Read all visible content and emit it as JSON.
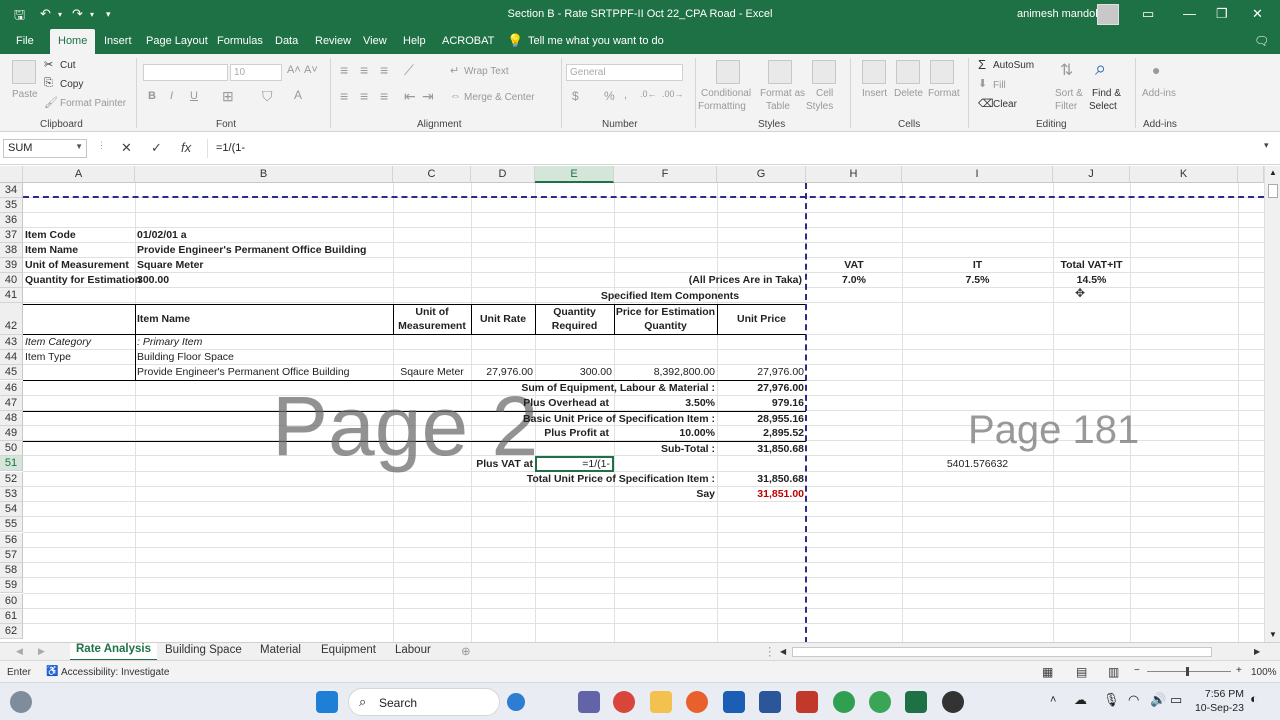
{
  "window": {
    "title": "Section B - Rate SRTPPF-II Oct 22_CPA Road  -  Excel",
    "user": "animesh mandol"
  },
  "ribbon_tabs": [
    "File",
    "Home",
    "Insert",
    "Page Layout",
    "Formulas",
    "Data",
    "Review",
    "View",
    "Help",
    "ACROBAT"
  ],
  "tell_me": "Tell me what you want to do",
  "ribbon": {
    "clipboard": {
      "paste": "Paste",
      "cut": "Cut",
      "copy": "Copy",
      "format_painter": "Format Painter",
      "label": "Clipboard"
    },
    "font": {
      "size": "10",
      "label": "Font"
    },
    "alignment": {
      "wrap": "Wrap Text",
      "merge": "Merge & Center",
      "label": "Alignment"
    },
    "number": {
      "format": "General",
      "label": "Number"
    },
    "styles": {
      "conditional": "Conditional",
      "conditional2": "Formatting",
      "format_as": "Format as",
      "format_as2": "Table",
      "cell": "Cell",
      "cell2": "Styles",
      "label": "Styles"
    },
    "cells": {
      "insert": "Insert",
      "delete": "Delete",
      "format": "Format",
      "label": "Cells"
    },
    "editing": {
      "autosum": "AutoSum",
      "fill": "Fill",
      "clear": "Clear",
      "sort": "Sort &",
      "sort2": "Filter",
      "find": "Find &",
      "find2": "Select",
      "label": "Editing"
    },
    "addins": {
      "addins": "Add-ins",
      "label": "Add-ins"
    }
  },
  "formula_bar": {
    "name_box": "SUM",
    "formula": "=1/(1-"
  },
  "columns": [
    "A",
    "B",
    "C",
    "D",
    "E",
    "F",
    "G",
    "H",
    "I",
    "J",
    "K"
  ],
  "rows": [
    "34",
    "35",
    "36",
    "37",
    "38",
    "39",
    "40",
    "41",
    "42",
    "43",
    "44",
    "45",
    "46",
    "47",
    "48",
    "49",
    "50",
    "51",
    "52",
    "53",
    "54",
    "55",
    "56",
    "57",
    "58",
    "59",
    "60",
    "61",
    "62"
  ],
  "cells": {
    "a37": "Item Code",
    "b37": "01/02/01 a",
    "a38": "Item Name",
    "b38": "Provide Engineer's Permanent Office Building",
    "a39": "Unit of Measurement",
    "b39": "Square Meter",
    "h39": "VAT",
    "i39": "IT",
    "j39": "Total VAT+IT",
    "a40": "Quantity for Estimation",
    "b40": "300.00",
    "g40": "(All Prices Are in Taka)",
    "h40": "7.0%",
    "i40": "7.5%",
    "j40": "14.5%",
    "f41": "Specified Item Components",
    "b42": "Item Name",
    "c42a": "Unit of",
    "c42b": "Measurement",
    "d42": "Unit Rate",
    "e42a": "Quantity",
    "e42b": "Required",
    "f42a": "Price for Estimation",
    "f42b": "Quantity",
    "g42": "Unit Price",
    "a43": "Item Category",
    "b43": ": Primary Item",
    "a44": "Item Type",
    "b44": "Building Floor Space",
    "b45": "Provide Engineer's Permanent Office Building",
    "c45": "Sqaure Meter",
    "d45": "27,976.00",
    "e45": "300.00",
    "f45": "8,392,800.00",
    "g45": "27,976.00",
    "f46": "Sum of Equipment, Labour & Material :",
    "g46": "27,976.00",
    "e47": "Plus Overhead at",
    "f47": "3.50%",
    "g47": "979.16",
    "f48": "Basic Unit Price of Specification Item :",
    "g48": "28,955.16",
    "e49": "Plus Profit at",
    "f49": "10.00%",
    "g49": "2,895.52",
    "f50": "Sub-Total :",
    "g50": "31,850.68",
    "d51": "Plus VAT at",
    "e51": "=1/(1-",
    "i51": "5401.576632",
    "f52": "Total Unit Price of Specification Item :",
    "g52": "31,850.68",
    "f53": "Say",
    "g53": "31,851.00"
  },
  "watermarks": {
    "left": "Page 2",
    "right": "Page 181"
  },
  "sheet_tabs": [
    "Rate Analysis",
    "Building Space",
    "Material",
    "Equipment",
    "Labour"
  ],
  "status": {
    "mode": "Enter",
    "accessibility": "Accessibility: Investigate",
    "zoom": "100%"
  },
  "taskbar": {
    "search": "Search",
    "time": "7:56 PM",
    "date": "10-Sep-23"
  },
  "colors": {
    "excel_green": "#1e7145",
    "say_red": "#c00000",
    "page_break": "#2b2b8c"
  }
}
